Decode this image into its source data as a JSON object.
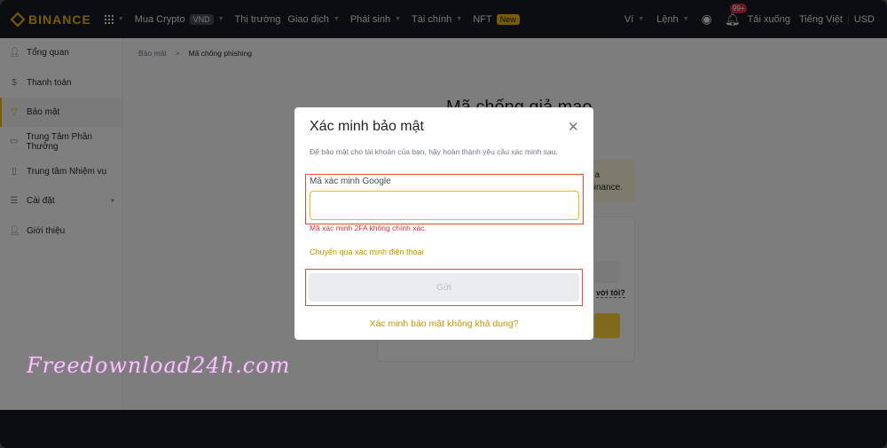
{
  "header": {
    "logo": "BINANCE",
    "nav": [
      {
        "label": "Mua Crypto",
        "badge": "VND",
        "caret": true
      },
      {
        "label": "Thị trường"
      },
      {
        "label": "Giao dịch",
        "caret": true
      },
      {
        "label": "Phái sinh",
        "caret": true
      },
      {
        "label": "Tài chính",
        "caret": true
      },
      {
        "label": "NFT",
        "new_badge": "New"
      }
    ],
    "right": {
      "wallet": "Ví",
      "orders": "Lệnh",
      "notifications": "99+",
      "download": "Tải xuống",
      "language": "Tiếng Việt",
      "currency": "USD"
    }
  },
  "sidebar": {
    "items": [
      {
        "label": "Tổng quan",
        "icon": "user-icon"
      },
      {
        "label": "Thanh toán",
        "icon": "dollar-icon"
      },
      {
        "label": "Bảo mật",
        "icon": "shield-icon",
        "active": true
      },
      {
        "label": "Trung Tâm Phần Thưởng",
        "icon": "ticket-icon"
      },
      {
        "label": "Trung tâm Nhiệm vụ",
        "icon": "clipboard-icon"
      },
      {
        "label": "Cài đặt",
        "icon": "settings-icon"
      },
      {
        "label": "Giới thiệu",
        "icon": "add-user-icon"
      }
    ]
  },
  "breadcrumb": {
    "parent": "Bảo mật",
    "current": "Mã chống phishing"
  },
  "background": {
    "title": "Mã chống giả mạo",
    "notice_line1": "a",
    "notice_line2": "Binance.",
    "link": "với tôi?"
  },
  "modal": {
    "title": "Xác minh bảo mật",
    "description": "Để bảo mật cho tài khoản của bạn, hãy hoàn thành yêu cầu xác minh sau.",
    "field_label": "Mã xác minh Google",
    "field_value": "",
    "error": "Mã xác minh 2FA không chính xác.",
    "switch_link": "Chuyển qua xác minh điện thoại",
    "submit": "Gửi",
    "unavailable_link": "Xác minh bảo mật không khả dụng?"
  },
  "watermark": "Freedownload24h.com",
  "colors": {
    "accent": "#f0b90b",
    "error": "#cf304a",
    "highlight": "#e8493f"
  }
}
